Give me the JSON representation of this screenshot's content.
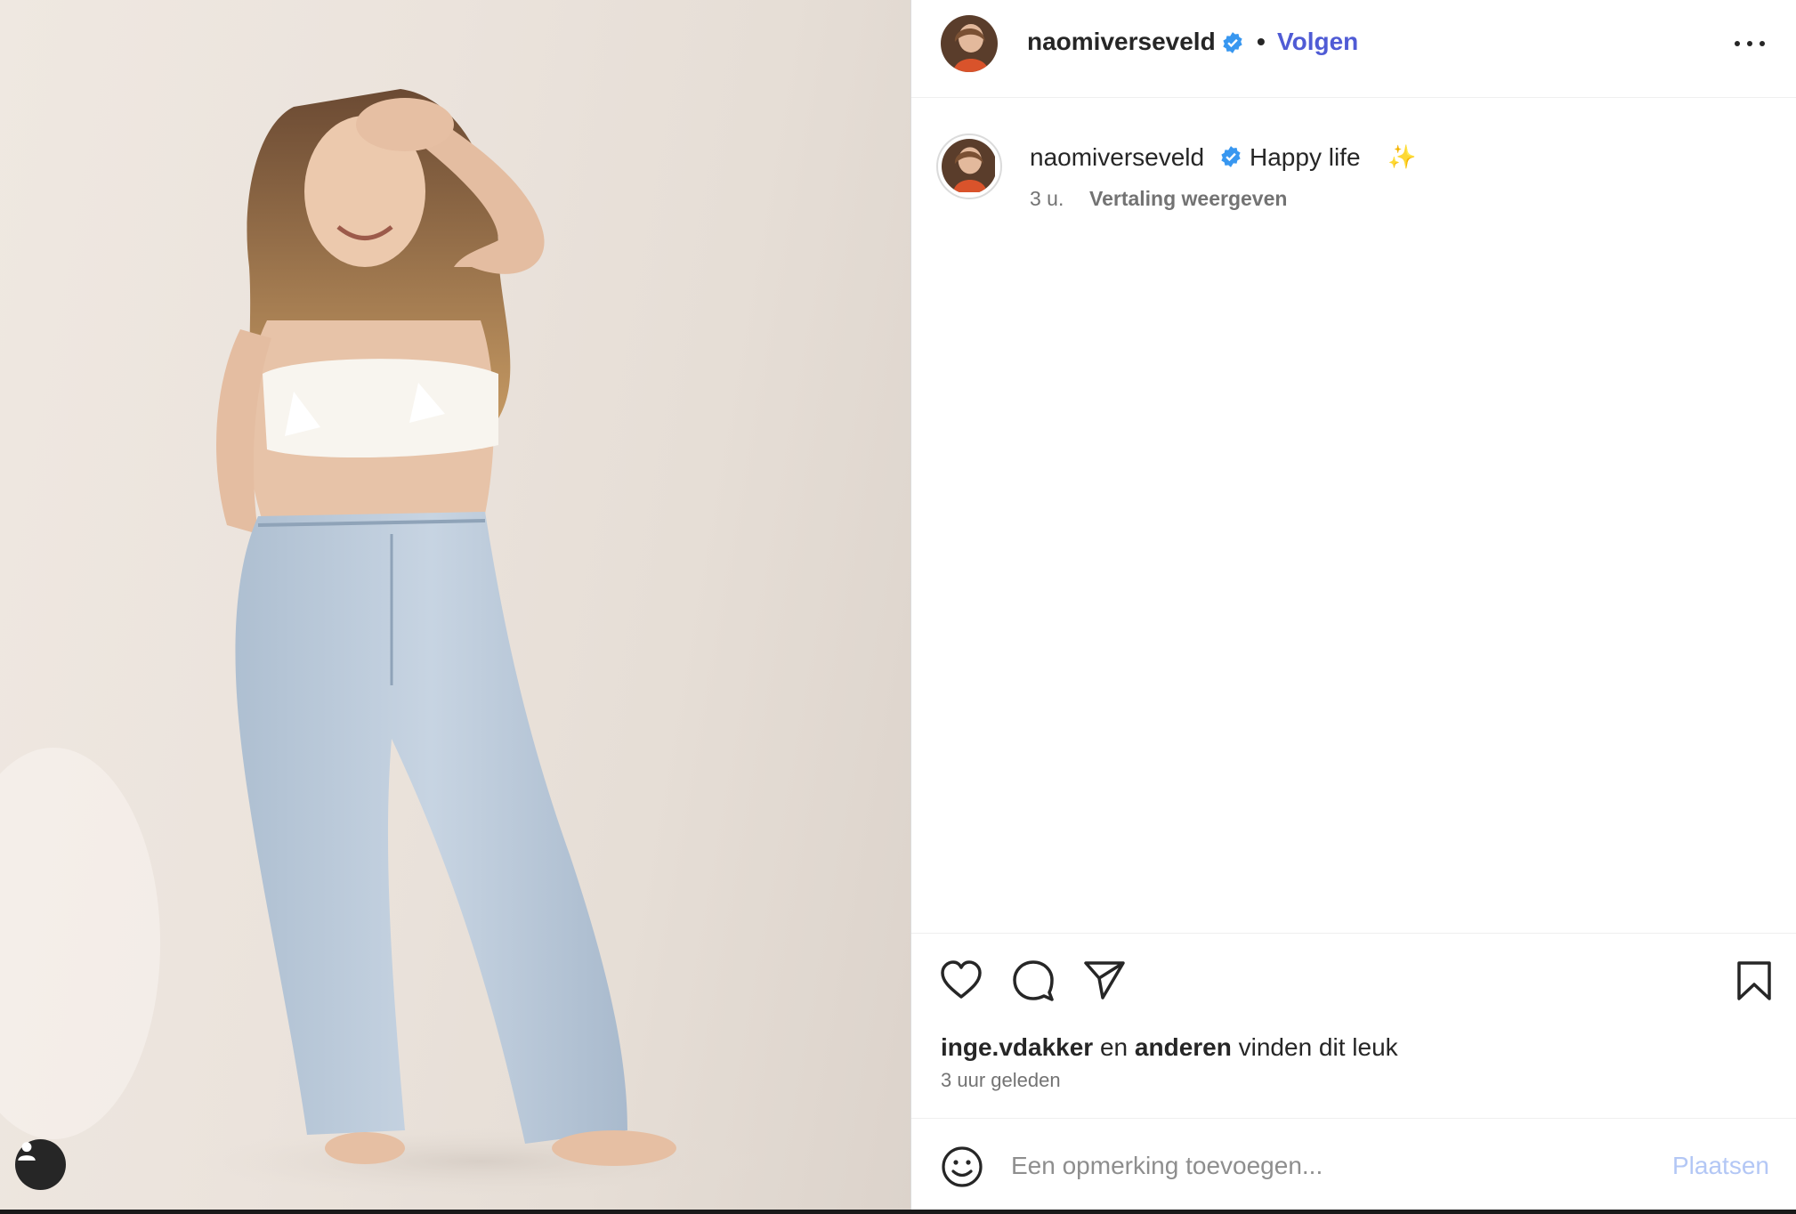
{
  "post": {
    "username": "naomiverseveld",
    "separator": "•",
    "follow_label": "Volgen",
    "caption_text": "Happy life",
    "caption_emoji": "✨",
    "caption_time": "3 u.",
    "translate_label": "Vertaling weergeven",
    "likes_user": "inge.vdakker",
    "likes_joiner": "en",
    "likes_others": "anderen",
    "likes_suffix": "vinden dit leuk",
    "posted_ago": "3 uur geleden"
  },
  "comment": {
    "placeholder": "Een opmerking toevoegen...",
    "post_label": "Plaatsen"
  },
  "icons": {
    "verified": "verified-badge-icon",
    "more": "more-options-icon",
    "like": "heart-icon",
    "comment": "comment-bubble-icon",
    "share": "paper-plane-icon",
    "save": "bookmark-icon",
    "emoji": "smiley-icon",
    "tag": "user-tag-icon"
  },
  "colors": {
    "follow": "#4f5bd5",
    "verified": "#3897f0",
    "post_button_disabled": "#b3c7f5",
    "secondary_text": "#737373"
  }
}
